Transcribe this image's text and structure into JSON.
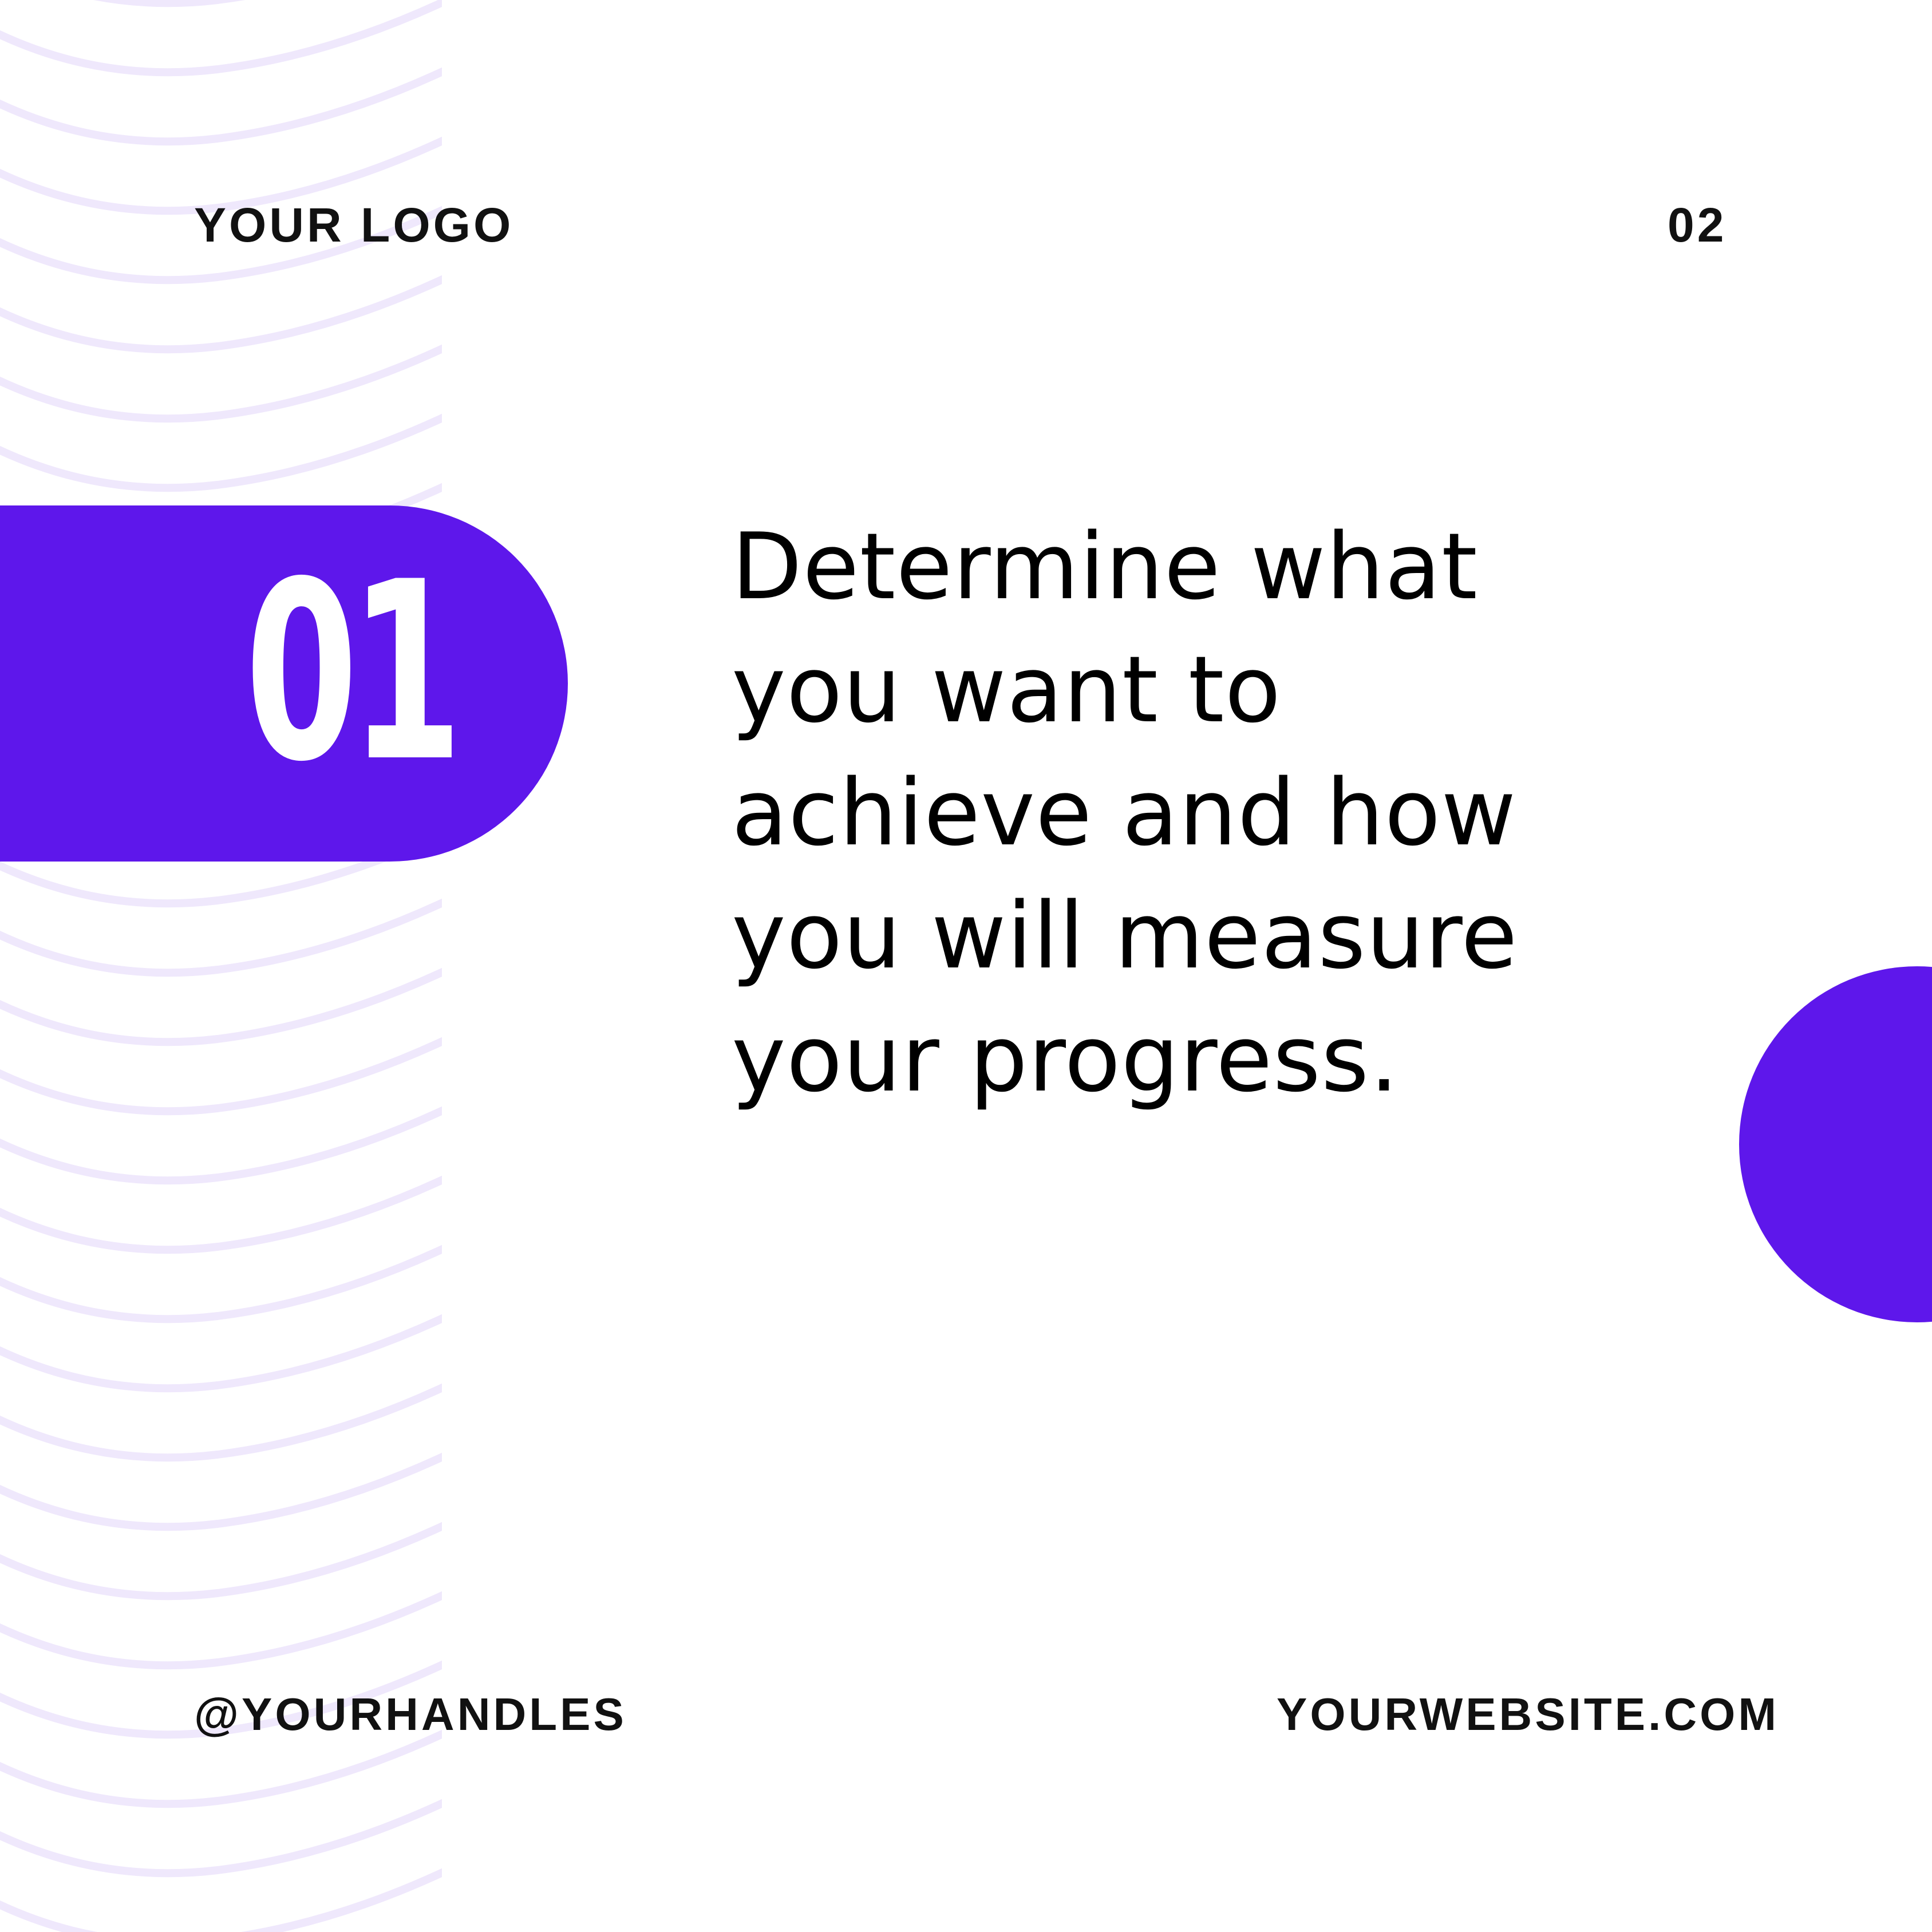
{
  "header": {
    "logo": "YOUR LOGO",
    "page_number": "02"
  },
  "step": {
    "number": "01",
    "text": "Determine what you want to achieve and how you will measure your progress."
  },
  "footer": {
    "handle": "@YOURHANDLES",
    "website": "YOURWEBSITE.COM"
  },
  "colors": {
    "accent": "#5E17EB",
    "wave": "#EFE8FC",
    "text": "#000000",
    "background": "#FFFFFF"
  }
}
